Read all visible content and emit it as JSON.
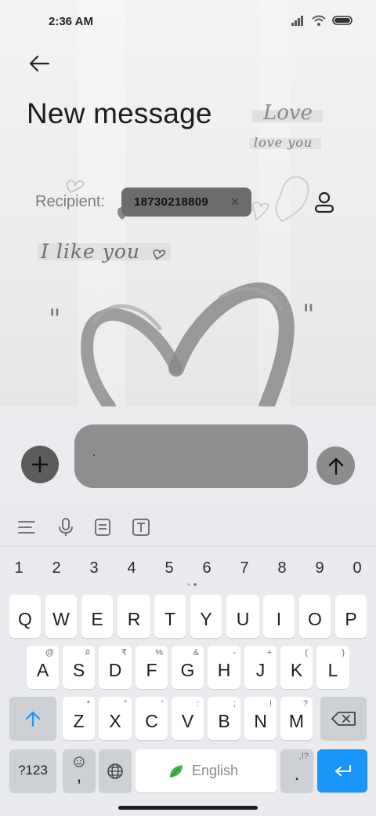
{
  "status": {
    "time": "2:36 AM",
    "icons": [
      "signal-icon",
      "wifi-icon",
      "battery-icon"
    ]
  },
  "header": {
    "title": "New message"
  },
  "recipient": {
    "label": "Recipient:",
    "chip_number": "18730218809",
    "chip_remove": "×"
  },
  "background": {
    "texts": [
      "Love",
      "love you",
      "I like you"
    ]
  },
  "compose": {
    "input_value": "."
  },
  "keyboard": {
    "toolbar_icons": [
      "menu-icon",
      "microphone-icon",
      "clipboard-icon",
      "text-format-icon"
    ],
    "numbers": [
      "1",
      "2",
      "3",
      "4",
      "5",
      "6",
      "7",
      "8",
      "9",
      "0"
    ],
    "row1": [
      {
        "key": "Q"
      },
      {
        "key": "W"
      },
      {
        "key": "E"
      },
      {
        "key": "R"
      },
      {
        "key": "T"
      },
      {
        "key": "Y"
      },
      {
        "key": "U"
      },
      {
        "key": "I"
      },
      {
        "key": "O"
      },
      {
        "key": "P"
      }
    ],
    "row2": [
      {
        "key": "A",
        "hint": "@"
      },
      {
        "key": "S",
        "hint": "#"
      },
      {
        "key": "D",
        "hint": "₹"
      },
      {
        "key": "F",
        "hint": "%"
      },
      {
        "key": "G",
        "hint": "&"
      },
      {
        "key": "H",
        "hint": "-"
      },
      {
        "key": "J",
        "hint": "+"
      },
      {
        "key": "K",
        "hint": "("
      },
      {
        "key": "L",
        "hint": ")"
      }
    ],
    "row3": [
      {
        "key": "Z",
        "hint": "*"
      },
      {
        "key": "X",
        "hint": "\""
      },
      {
        "key": "C",
        "hint": "'"
      },
      {
        "key": "V",
        "hint": ":"
      },
      {
        "key": "B",
        "hint": ";"
      },
      {
        "key": "N",
        "hint": "!"
      },
      {
        "key": "M",
        "hint": "?"
      }
    ],
    "symbols_label": "?123",
    "comma_label": ",",
    "space_label": "English",
    "period_label": ".",
    "period_hint": ",!?"
  },
  "colors": {
    "accent": "#1a95f5",
    "chip_bg": "#6c6c6c",
    "input_bg": "#8d8f8e",
    "keyboard_bg": "#e8eaed"
  }
}
